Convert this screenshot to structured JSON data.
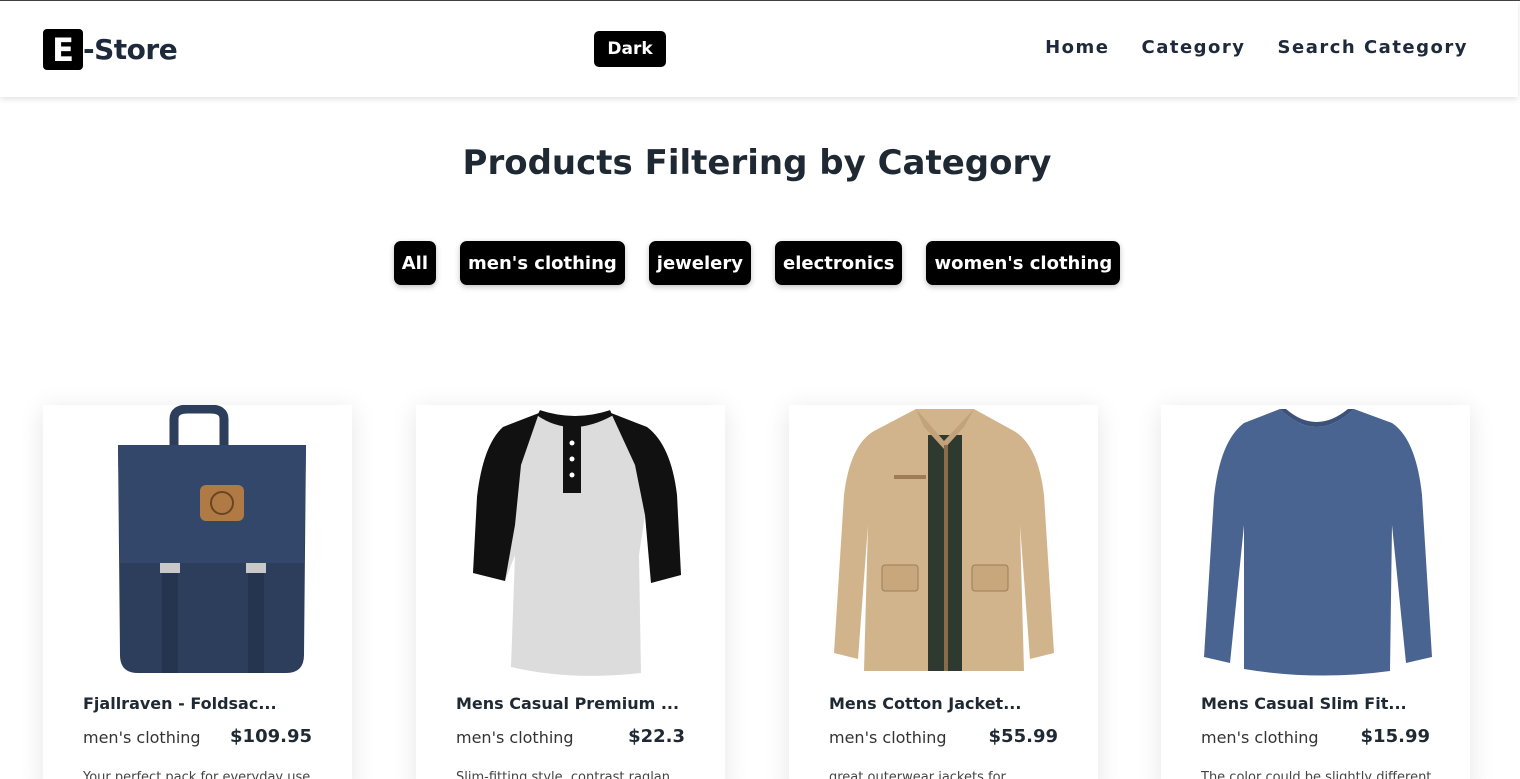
{
  "brand": {
    "mark": "E",
    "name": "-Store"
  },
  "theme_toggle": {
    "label": "Dark"
  },
  "nav": {
    "items": [
      {
        "label": "Home"
      },
      {
        "label": "Category"
      },
      {
        "label": "Search Category"
      }
    ]
  },
  "page": {
    "title": "Products Filtering by Category"
  },
  "filters": {
    "items": [
      {
        "label": "All"
      },
      {
        "label": "men's clothing"
      },
      {
        "label": "jewelery"
      },
      {
        "label": "electronics"
      },
      {
        "label": "women's clothing"
      }
    ]
  },
  "products": [
    {
      "title": "Fjallraven - Foldsac...",
      "category": "men's clothing",
      "price": "$109.95",
      "description": "Your perfect pack for everyday use",
      "image": "backpack"
    },
    {
      "title": "Mens Casual Premium ...",
      "category": "men's clothing",
      "price": "$22.3",
      "description": "Slim-fitting style, contrast raglan",
      "image": "raglan-tshirt"
    },
    {
      "title": "Mens Cotton Jacket...",
      "category": "men's clothing",
      "price": "$55.99",
      "description": "great outerwear jackets for",
      "image": "cotton-jacket"
    },
    {
      "title": "Mens Casual Slim Fit...",
      "category": "men's clothing",
      "price": "$15.99",
      "description": "The color could be slightly different",
      "image": "longsleeve-shirt"
    }
  ],
  "colors": {
    "button_bg": "#000000",
    "button_text": "#ffffff",
    "heading": "#1f2933",
    "backpack": "#2c3e5c",
    "jacket": "#d2b48c",
    "shirt": "#4a6491"
  }
}
